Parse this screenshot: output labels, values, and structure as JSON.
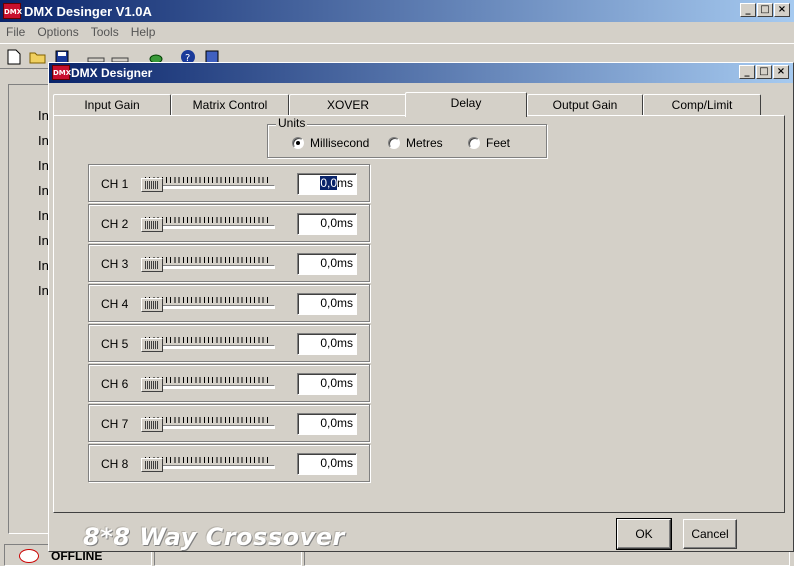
{
  "main_window": {
    "icon_text": "DMX",
    "title": "DMX Desinger V1.0A",
    "menu": [
      "File",
      "Options",
      "Tools",
      "Help"
    ],
    "background_labels": [
      "In",
      "In",
      "In",
      "In",
      "In",
      "In",
      "In",
      "In"
    ],
    "status_text": "OFFLINE"
  },
  "dialog": {
    "icon_text": "DMX",
    "title": "DMX Designer",
    "tabs": [
      {
        "label": "Input Gain",
        "active": false
      },
      {
        "label": "Matrix Control",
        "active": false
      },
      {
        "label": "XOVER",
        "active": false
      },
      {
        "label": "Delay",
        "active": true
      },
      {
        "label": "Output Gain",
        "active": false
      },
      {
        "label": "Comp/Limit",
        "active": false
      }
    ],
    "units": {
      "legend": "Units",
      "options": [
        "Millisecond",
        "Metres",
        "Feet"
      ],
      "selected": "Millisecond"
    },
    "channels": [
      {
        "label": "CH 1",
        "value": "0,0ms",
        "slider_level": 0
      },
      {
        "label": "CH 2",
        "value": "0,0ms",
        "slider_level": 0
      },
      {
        "label": "CH 3",
        "value": "0,0ms",
        "slider_level": 0
      },
      {
        "label": "CH 4",
        "value": "0,0ms",
        "slider_level": 0
      },
      {
        "label": "CH 5",
        "value": "0,0ms",
        "slider_level": 0
      },
      {
        "label": "CH 6",
        "value": "0,0ms",
        "slider_level": 0
      },
      {
        "label": "CH 7",
        "value": "0,0ms",
        "slider_level": 0
      },
      {
        "label": "CH 8",
        "value": "0,0ms",
        "slider_level": 0
      }
    ],
    "watermark": "8*8 Way Crossover",
    "ok_label": "OK",
    "cancel_label": "Cancel"
  }
}
